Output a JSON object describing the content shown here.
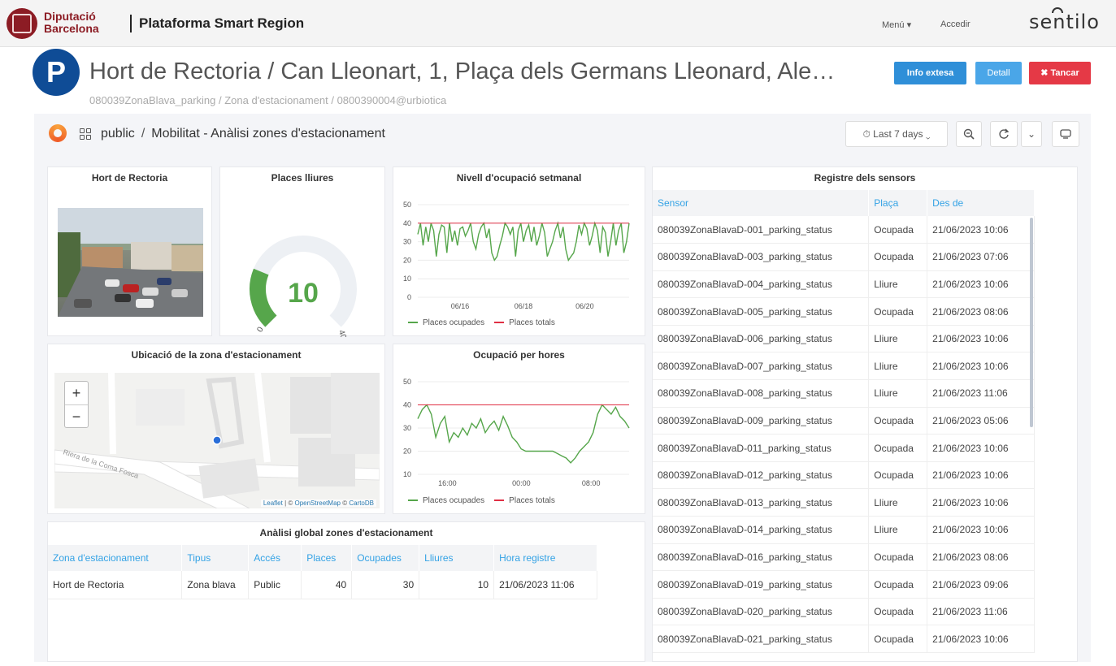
{
  "nav": {
    "logo_line1": "Diputació",
    "logo_line2": "Barcelona",
    "platform_title": "Plataforma Smart Region",
    "menu_label": "Menú ▾",
    "login_label": "Accedir",
    "sentilo_logo": "sentilo"
  },
  "header": {
    "badge": "P",
    "title": "Hort de Rectoria / Can Lleonart, 1, Plaça dels Germans Lleonard, Ale…",
    "subtitle": "080039ZonaBlava_parking / Zona d'estacionament / 0800390004@urbiotica",
    "info_button": "Info extesa",
    "detail_button": "Detall",
    "close_button": "✖ Tancar"
  },
  "grafana": {
    "crumb_folder": "public",
    "crumb_sep": "/",
    "crumb_dashboard": "Mobilitat - Anàlisi zones d'estacionament",
    "time_range": "⏱ Last 7 days ⌄",
    "zoom_icon": "zoom-out-icon",
    "refresh_icon": "refresh-icon"
  },
  "panels": {
    "photo_title": "Hort de Rectoria",
    "gauge_title": "Places lliures",
    "gauge": {
      "value": 10,
      "display": "10",
      "min": "0",
      "max": "40",
      "color": "#56a64b"
    },
    "weekly_title": "Nivell d'ocupació setmanal",
    "hourly_title": "Ocupació per hores",
    "map_title": "Ubicació de la zona d'estacionament",
    "map_zoom_in": "+",
    "map_zoom_out": "−",
    "map_street": "Riera de la Coma Fosca",
    "attribution": {
      "leaflet": "Leaflet",
      "sep1": " | © ",
      "osm": "OpenStreetMap",
      "sep2": " © ",
      "carto": "CartoDB"
    },
    "legend_occupied": "Places ocupades",
    "legend_total": "Places totals",
    "global_title": "Anàlisi global zones d'estacionament",
    "sensors_title": "Registre dels sensors"
  },
  "chart_data": [
    {
      "type": "line",
      "title": "Nivell d'ocupació setmanal",
      "x_ticks": [
        "06/16",
        "06/18",
        "06/20"
      ],
      "y_ticks": [
        0,
        10,
        20,
        30,
        40,
        50
      ],
      "ylim": [
        0,
        50
      ],
      "series": [
        {
          "name": "Places ocupades",
          "color": "#56a64b",
          "values": [
            34,
            40,
            28,
            38,
            30,
            40,
            36,
            22,
            34,
            39,
            38,
            24,
            40,
            30,
            36,
            28,
            37,
            38,
            33,
            36,
            40,
            30,
            26,
            34,
            38,
            40,
            32,
            37,
            24,
            20,
            22,
            28,
            33,
            40,
            38,
            34,
            38,
            22,
            36,
            40,
            30,
            36,
            39,
            30,
            38,
            28,
            33,
            40,
            35,
            22,
            26,
            30,
            36,
            40,
            32,
            38,
            26,
            20,
            22,
            24,
            30,
            39,
            34,
            40,
            37,
            28,
            33,
            40,
            36,
            24,
            38,
            35,
            22,
            30,
            40,
            28,
            36,
            40,
            24,
            30,
            40
          ]
        },
        {
          "name": "Places totals",
          "color": "#e02f44",
          "values": [
            40,
            40
          ]
        }
      ],
      "legend": "bottom-left"
    },
    {
      "type": "line",
      "title": "Ocupació per hores",
      "x_ticks": [
        "16:00",
        "00:00",
        "08:00"
      ],
      "y_ticks": [
        10,
        20,
        30,
        40,
        50
      ],
      "ylim": [
        10,
        50
      ],
      "series": [
        {
          "name": "Places ocupades",
          "color": "#56a64b",
          "values": [
            34,
            38,
            40,
            36,
            26,
            32,
            35,
            24,
            28,
            26,
            30,
            27,
            32,
            30,
            34,
            28,
            31,
            33,
            29,
            35,
            31,
            26,
            24,
            21,
            20,
            20,
            20,
            20,
            20,
            20,
            20,
            19,
            18,
            17,
            15,
            17,
            20,
            22,
            24,
            28,
            36,
            40,
            38,
            36,
            39,
            35,
            33,
            30
          ]
        },
        {
          "name": "Places totals",
          "color": "#e02f44",
          "values": [
            40,
            40
          ]
        }
      ],
      "legend": "bottom-left"
    }
  ],
  "global_table": {
    "headers": [
      "Zona d'estacionament",
      "Tipus",
      "Accés",
      "Places",
      "Ocupades",
      "Lliures",
      "Hora registre"
    ],
    "rows": [
      [
        "Hort de Rectoria",
        "Zona blava",
        "Public",
        "40",
        "30",
        "10",
        "21/06/2023 11:06"
      ]
    ]
  },
  "sensor_table": {
    "headers": [
      "Sensor",
      "Plaça",
      "Des de"
    ],
    "rows": [
      [
        "080039ZonaBlavaD-001_parking_status",
        "Ocupada",
        "21/06/2023 10:06"
      ],
      [
        "080039ZonaBlavaD-003_parking_status",
        "Ocupada",
        "21/06/2023 07:06"
      ],
      [
        "080039ZonaBlavaD-004_parking_status",
        "Lliure",
        "21/06/2023 10:06"
      ],
      [
        "080039ZonaBlavaD-005_parking_status",
        "Ocupada",
        "21/06/2023 08:06"
      ],
      [
        "080039ZonaBlavaD-006_parking_status",
        "Lliure",
        "21/06/2023 10:06"
      ],
      [
        "080039ZonaBlavaD-007_parking_status",
        "Lliure",
        "21/06/2023 10:06"
      ],
      [
        "080039ZonaBlavaD-008_parking_status",
        "Lliure",
        "21/06/2023 11:06"
      ],
      [
        "080039ZonaBlavaD-009_parking_status",
        "Ocupada",
        "21/06/2023 05:06"
      ],
      [
        "080039ZonaBlavaD-011_parking_status",
        "Ocupada",
        "21/06/2023 10:06"
      ],
      [
        "080039ZonaBlavaD-012_parking_status",
        "Ocupada",
        "21/06/2023 10:06"
      ],
      [
        "080039ZonaBlavaD-013_parking_status",
        "Lliure",
        "21/06/2023 10:06"
      ],
      [
        "080039ZonaBlavaD-014_parking_status",
        "Lliure",
        "21/06/2023 10:06"
      ],
      [
        "080039ZonaBlavaD-016_parking_status",
        "Ocupada",
        "21/06/2023 08:06"
      ],
      [
        "080039ZonaBlavaD-019_parking_status",
        "Ocupada",
        "21/06/2023 09:06"
      ],
      [
        "080039ZonaBlavaD-020_parking_status",
        "Ocupada",
        "21/06/2023 11:06"
      ],
      [
        "080039ZonaBlavaD-021_parking_status",
        "Ocupada",
        "21/06/2023 10:06"
      ]
    ]
  },
  "colors": {
    "accent": "#33a2e5",
    "brand": "#8c1c24",
    "badge": "#0f4c96",
    "danger": "#e53946"
  }
}
